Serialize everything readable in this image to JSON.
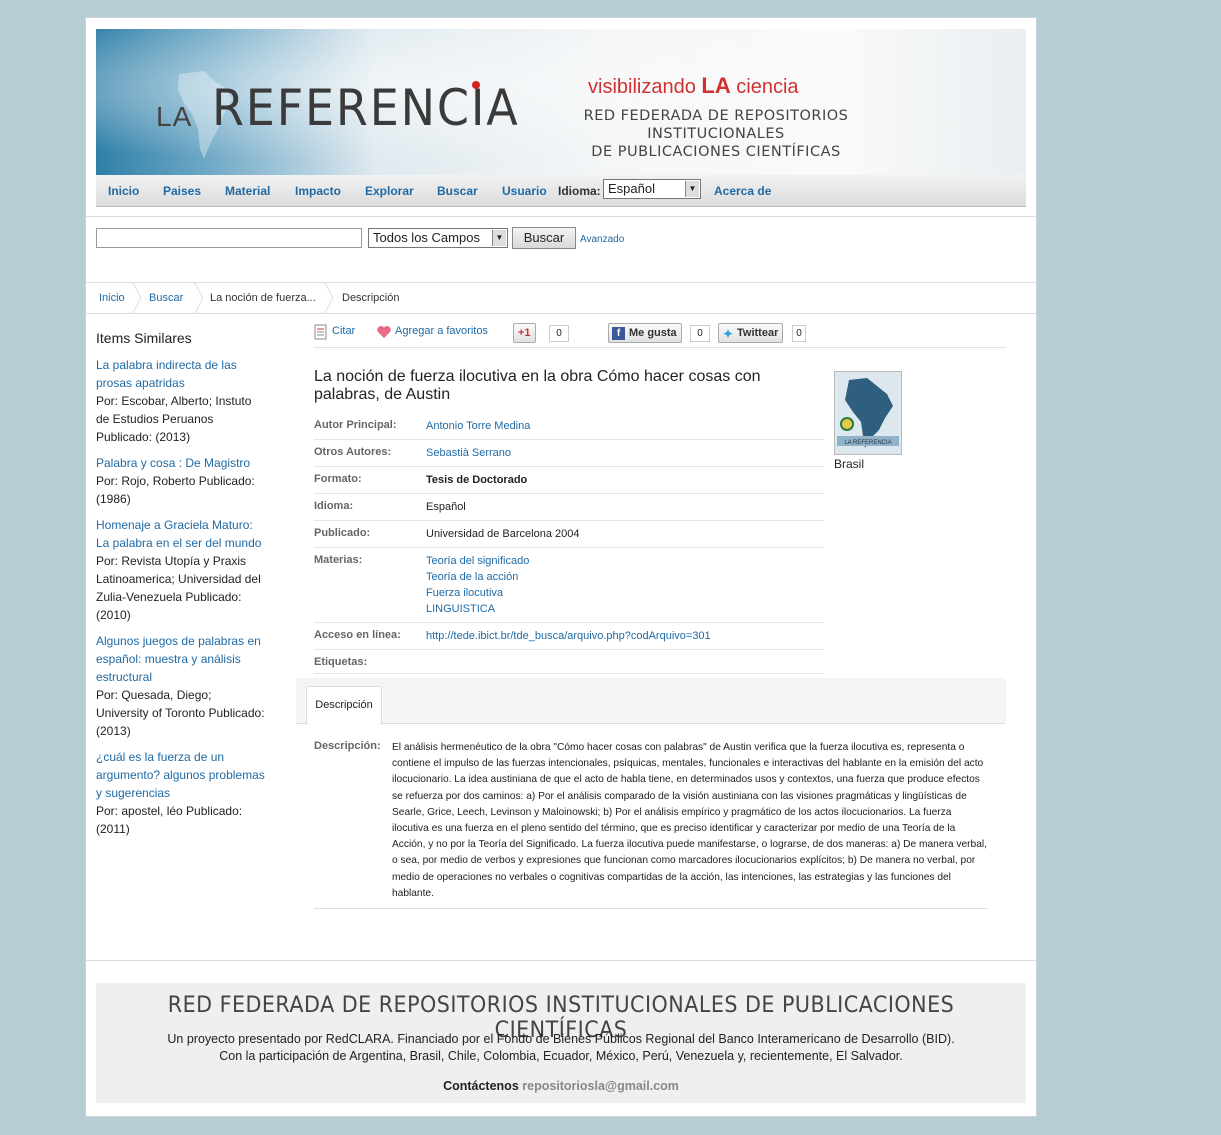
{
  "header": {
    "logo_la": "LA",
    "logo_text": "REFERENCIA",
    "tagline_pre": "visibilizando ",
    "tagline_la": "LA",
    "tagline_post": " ciencia",
    "network_line1": "RED FEDERADA DE REPOSITORIOS INSTITUCIONALES",
    "network_line2": "DE PUBLICACIONES CIENTÍFICAS"
  },
  "nav": {
    "items": [
      "Inicio",
      "Paises",
      "Material",
      "Impacto",
      "Explorar",
      "Buscar",
      "Usuario"
    ],
    "idioma_label": "Idioma:",
    "idioma_value": "Español",
    "acerca": "Acerca de"
  },
  "search": {
    "query": "",
    "field": "Todos los Campos",
    "button": "Buscar",
    "advanced": "Avanzado"
  },
  "breadcrumb": [
    "Inicio",
    "Buscar",
    "La noción de fuerza...",
    "Descripción"
  ],
  "sidebar": {
    "title": "Items Similares",
    "items": [
      {
        "title": "La palabra indirecta de las prosas apatridas",
        "meta": "Por: Escobar, Alberto; Instuto de Estudios Peruanos Publicado: (2013)"
      },
      {
        "title": "Palabra y cosa : De Magistro",
        "meta": "Por: Rojo, Roberto Publicado: (1986)"
      },
      {
        "title": "Homenaje a Graciela Maturo: La palabra en el ser del mundo",
        "meta": "Por: Revista Utopía y Praxis Latinoamerica; Universidad del Zulia-Venezuela Publicado: (2010)"
      },
      {
        "title": "Algunos juegos de palabras en español: muestra y análisis estructural",
        "meta": "Por: Quesada, Diego; University of Toronto Publicado: (2013)"
      },
      {
        "title": "¿cuál es la fuerza de un argumento? algunos problemas y sugerencias",
        "meta": "Por: apostel, léo Publicado: (2011)"
      }
    ]
  },
  "toolbar": {
    "cite": "Citar",
    "favorites": "Agregar a favoritos",
    "gplus": "+1",
    "gplus_count": "0",
    "like": "Me gusta",
    "like_count": "0",
    "twitter": "Twittear",
    "twitter_count": "0"
  },
  "record": {
    "title": "La noción de fuerza ilocutiva en la obra Cómo hacer cosas con palabras, de Austin",
    "autor_label": "Autor Principal:",
    "autor": "Antonio Torre Medina",
    "otros_label": "Otros Autores:",
    "otros": "Sebastià Serrano",
    "formato_label": "Formato:",
    "formato": "Tesis de Doctorado",
    "idioma_label": "Idioma:",
    "idioma": "Español",
    "publicado_label": "Publicado:",
    "publicado": "Universidad de Barcelona 2004",
    "materias_label": "Materias:",
    "materias": [
      "Teoría del significado",
      "Teoría de la acción",
      "Fuerza ilocutiva",
      "LINGUISTICA"
    ],
    "acceso_label": "Acceso en línea:",
    "acceso": "http://tede.ibict.br/tde_busca/arquivo.php?codArquivo=301",
    "etiquetas_label": "Etiquetas:",
    "country": "Brasil",
    "thumb_text": "LA REFERENCIA"
  },
  "tab": {
    "label": "Descripción"
  },
  "description": {
    "label": "Descripción:",
    "text": "El análisis hermenéutico de la obra \"Cómo hacer cosas con palabras\" de Austin verifica que la fuerza ilocutiva es, representa o contiene el impulso de las fuerzas intencionales, psíquicas, mentales, funcionales e interactivas del hablante en la emisión del acto ilocucionario. La idea austiniana de que el acto de habla tiene, en determinados usos y contextos, una fuerza que produce efectos se refuerza por dos caminos: a) Por el análisis comparado de la visión austiniana con las visiones pragmáticas y lingüísticas de Searle, Grice, Leech, Levinson y Maloinowski; b) Por el análisis empírico y pragmático de los actos ilocucionarios. La fuerza ilocutiva es una fuerza en el pleno sentido del término, que es preciso identificar y caracterizar por medio de una Teoría de la Acción, y no por la Teoría del Significado. La fuerza ilocutiva puede manifestarse, o lograrse, de dos maneras: a) De manera verbal, o sea, por medio de verbos y expresiones que funcionan como marcadores ilocucionarios explícitos; b) De manera no verbal, por medio de operaciones no verbales o cognitivas compartidas de la acción, las intenciones, las estrategias y las funciones del hablante."
  },
  "footer": {
    "title": "RED FEDERADA DE REPOSITORIOS INSTITUCIONALES DE PUBLICACIONES CIENTÍFICAS",
    "line1": "Un proyecto presentado por RedCLARA. Financiado por el Fondo de Bienes Públicos Regional del Banco Interamericano de Desarrollo (BID).",
    "line2": "Con la participación de Argentina, Brasil, Chile, Colombia, Ecuador, México, Perú, Venezuela y, recientemente, El Salvador.",
    "contact_label": "Contáctenos",
    "contact_email": "repositoriosla@gmail.com"
  },
  "colors": {
    "link": "#1f6aa5",
    "accent_red": "#d82020",
    "page_bg": "#b8ccd6"
  }
}
